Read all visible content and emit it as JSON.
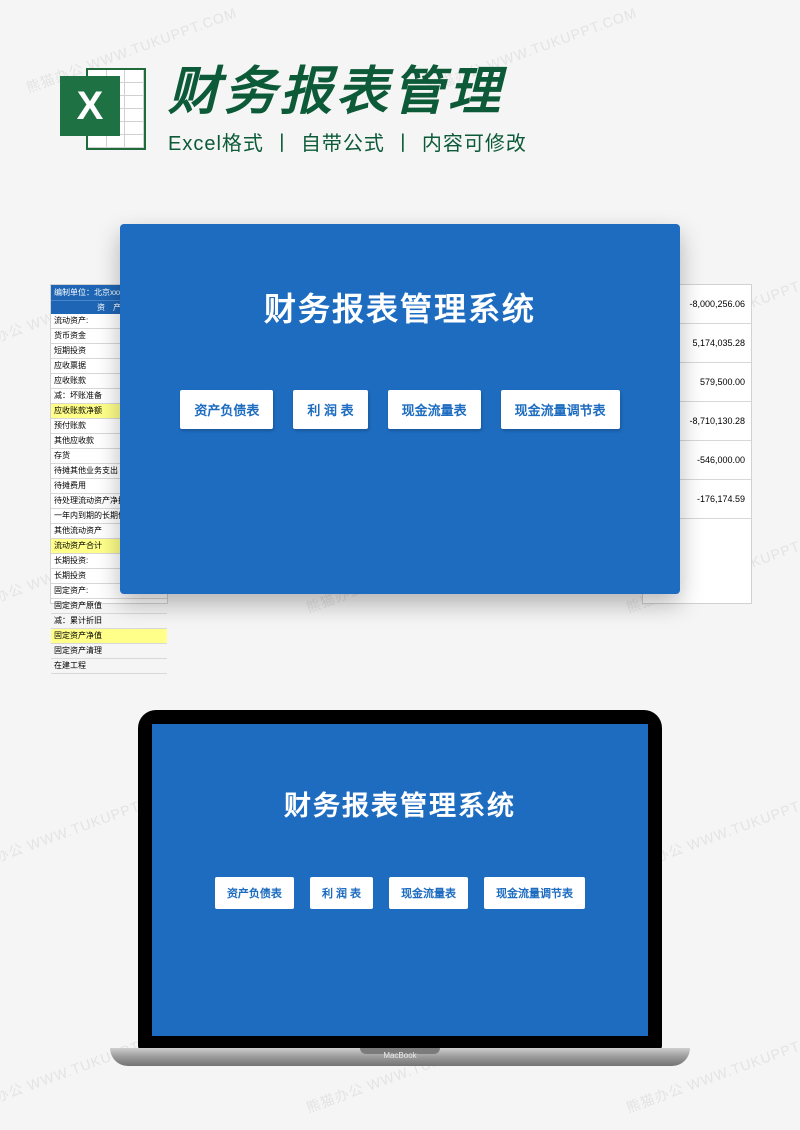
{
  "header": {
    "icon_letter": "X",
    "title": "财务报表管理",
    "sub1": "Excel格式",
    "sub2": "自带公式",
    "sub3": "内容可修改",
    "sep": "丨"
  },
  "watermark_text": "熊猫办公 WWW.TUKUPPT.COM",
  "card": {
    "title": "财务报表管理系统",
    "buttons": [
      "资产负债表",
      "利 润 表",
      "现金流量表",
      "现金流量调节表"
    ]
  },
  "left_table": {
    "header_top": "编制单位：北京xxxx有限…",
    "header_row": "资　产",
    "rows": [
      {
        "t": "流动资产:",
        "hl": false
      },
      {
        "t": "货币资金",
        "hl": false
      },
      {
        "t": "短期投资",
        "hl": false
      },
      {
        "t": "应收票据",
        "hl": false
      },
      {
        "t": "应收账款",
        "hl": false
      },
      {
        "t": "减：坏账准备",
        "hl": false
      },
      {
        "t": "应收账款净额",
        "hl": true
      },
      {
        "t": "预付账款",
        "hl": false
      },
      {
        "t": "其他应收款",
        "hl": false
      },
      {
        "t": "存货",
        "hl": false
      },
      {
        "t": "待摊其他业务支出",
        "hl": false
      },
      {
        "t": "待摊费用",
        "hl": false
      },
      {
        "t": "待处理流动资产净损",
        "hl": false
      },
      {
        "t": "一年内到期的长期债",
        "hl": false
      },
      {
        "t": "其他流动资产",
        "hl": false
      },
      {
        "t": "流动资产合计",
        "hl": true
      },
      {
        "t": "长期投资:",
        "hl": false
      },
      {
        "t": "长期投资",
        "hl": false
      },
      {
        "t": "固定资产:",
        "hl": false
      },
      {
        "t": "固定资产原值",
        "hl": false
      },
      {
        "t": "减：累计折旧",
        "hl": false
      },
      {
        "t": "固定资产净值",
        "hl": true
      },
      {
        "t": "固定资产清理",
        "hl": false
      },
      {
        "t": "在建工程",
        "hl": false
      }
    ]
  },
  "right_table": {
    "values": [
      "-8,000,256.06",
      "5,174,035.28",
      "579,500.00",
      "-8,710,130.28",
      "-546,000.00",
      "-176,174.59"
    ]
  },
  "laptop": {
    "brand": "MacBook"
  }
}
